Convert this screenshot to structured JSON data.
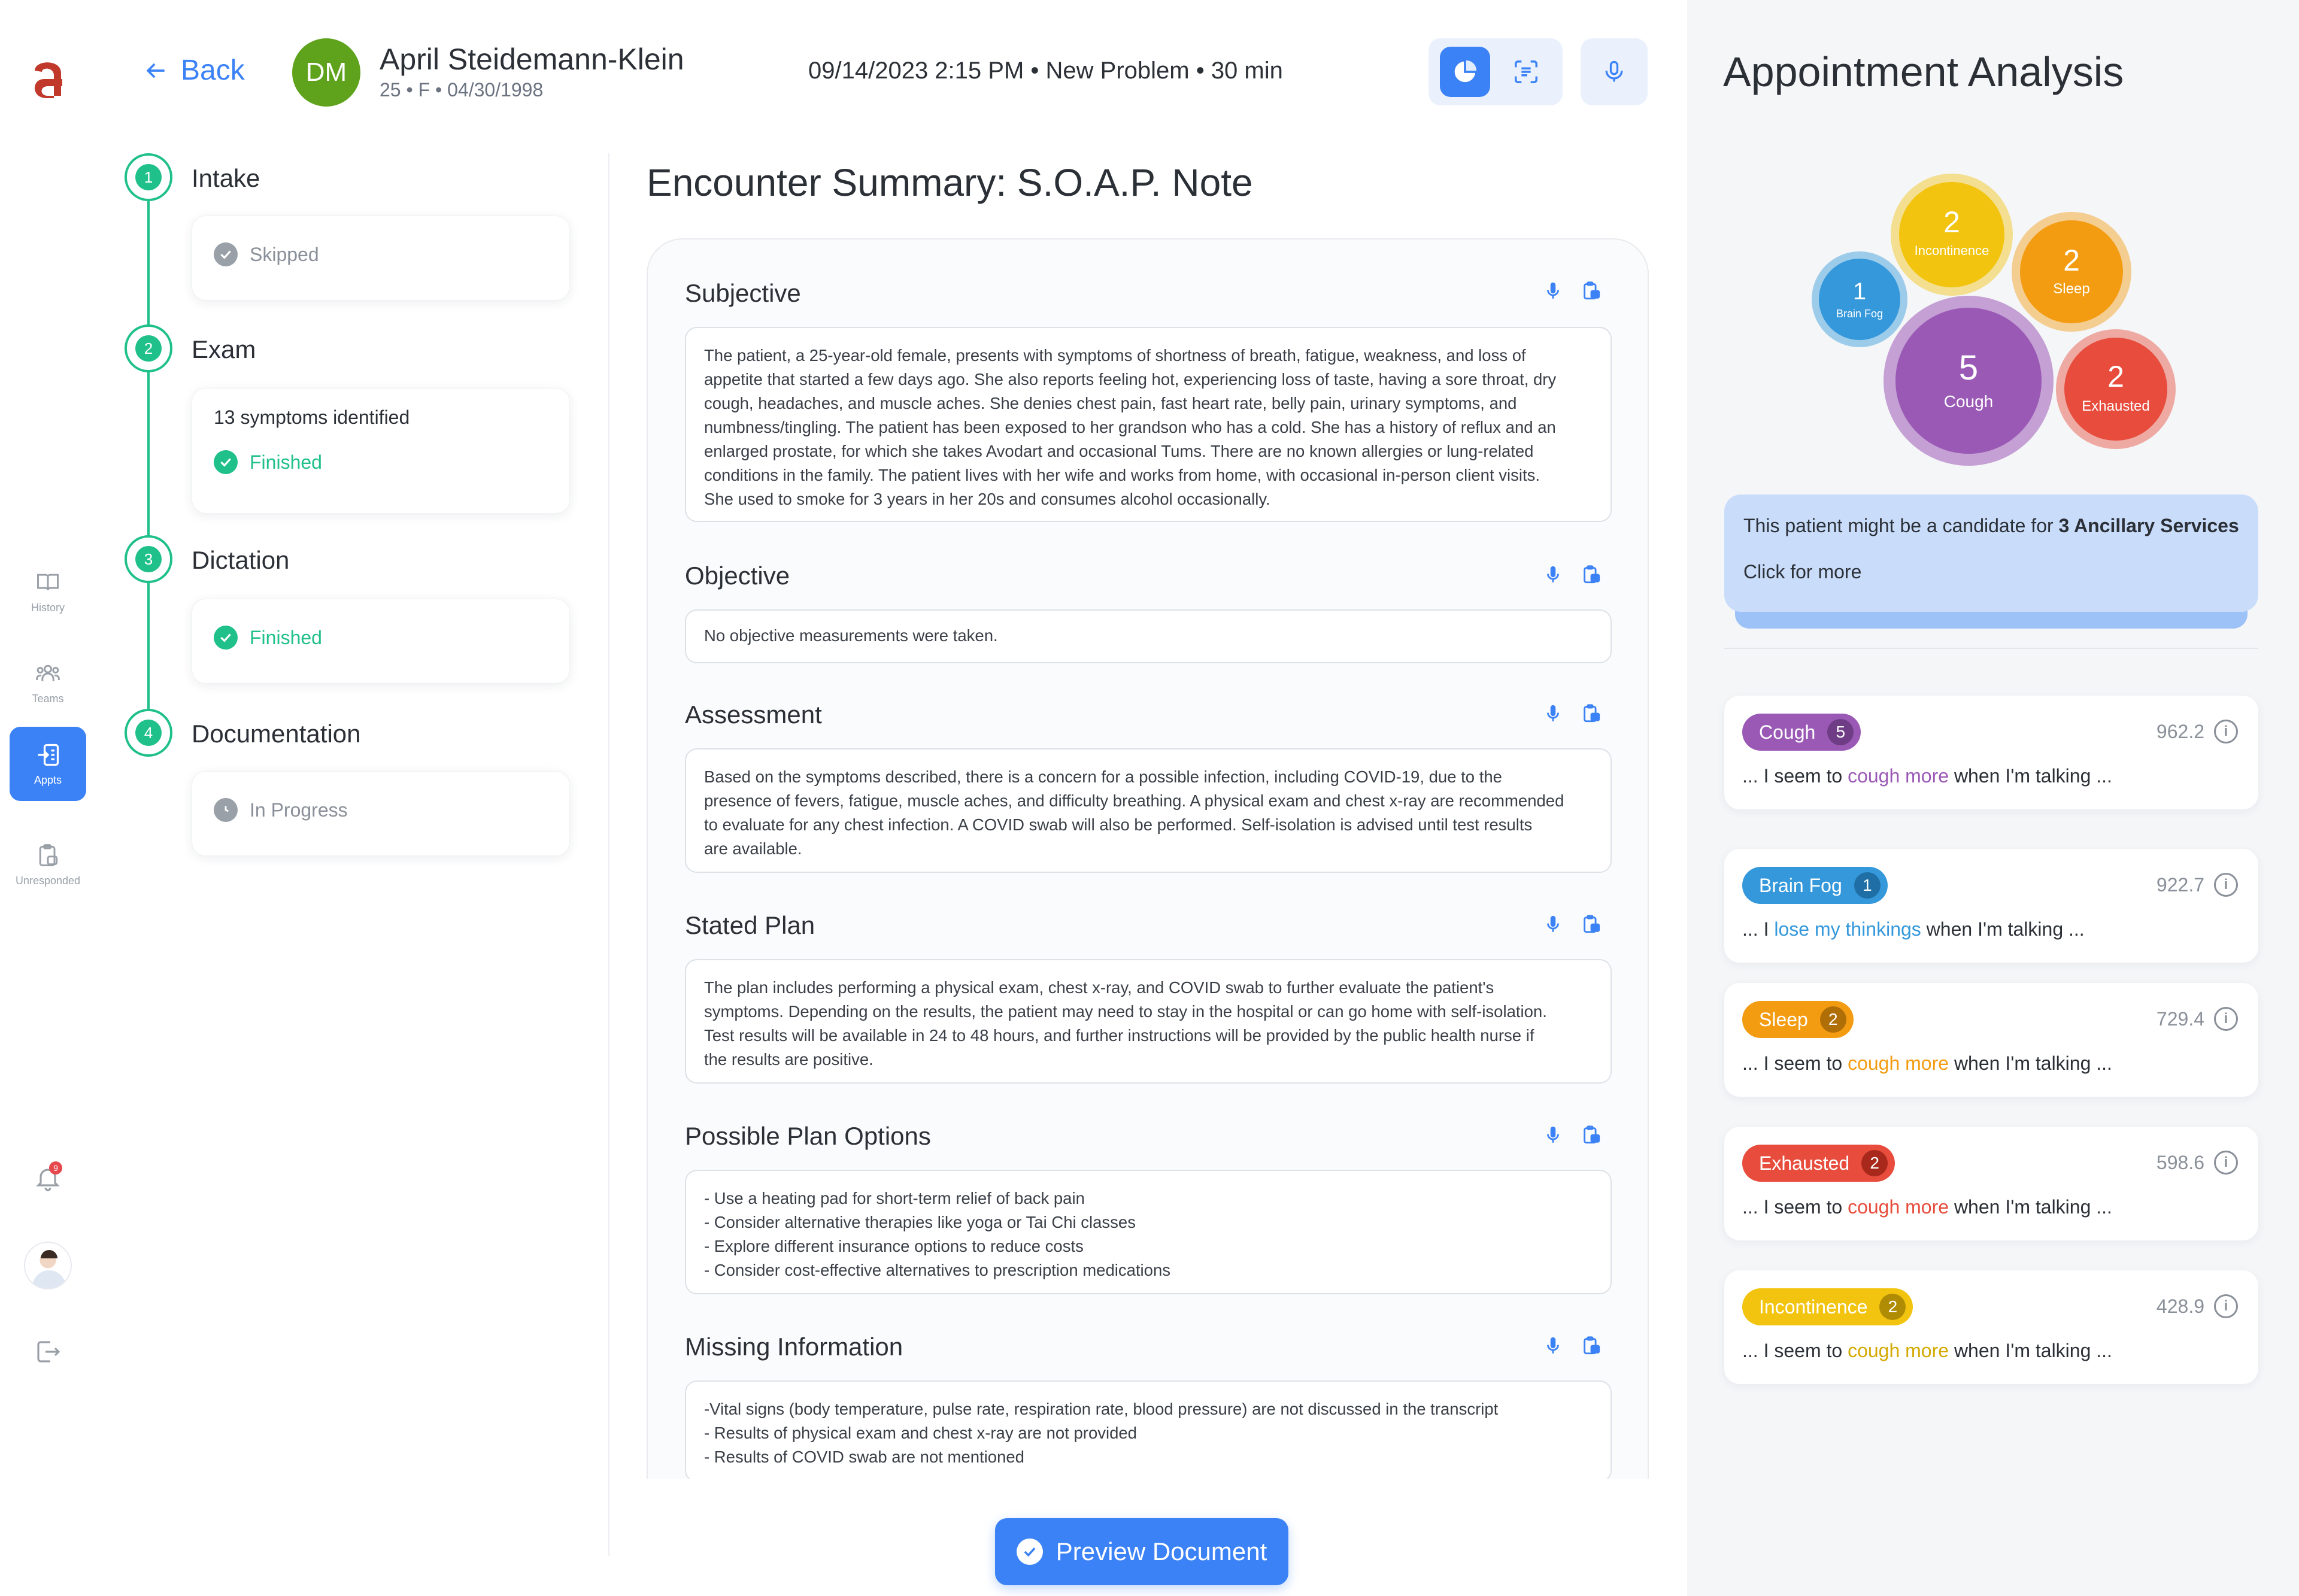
{
  "nav": {
    "items": [
      {
        "label": "History"
      },
      {
        "label": "Teams"
      },
      {
        "label": "Appts"
      },
      {
        "label": "Unresponded"
      }
    ],
    "notification_count": "9"
  },
  "header": {
    "back_label": "Back",
    "patient_initials": "DM",
    "patient_name": "April Steidemann-Klein",
    "patient_meta": "25 • F • 04/30/1998",
    "appointment": "09/14/2023 2:15 PM • New Problem • 30 min"
  },
  "steps": [
    {
      "num": "1",
      "title": "Intake",
      "status": "Skipped"
    },
    {
      "num": "2",
      "title": "Exam",
      "detail": "13 symptoms identified",
      "status": "Finished"
    },
    {
      "num": "3",
      "title": "Dictation",
      "status": "Finished"
    },
    {
      "num": "4",
      "title": "Documentation",
      "status": "In Progress"
    }
  ],
  "soap": {
    "title": "Encounter Summary: S.O.A.P. Note",
    "sections": [
      {
        "title": "Subjective",
        "text": "The patient, a 25-year-old female, presents with symptoms of shortness of breath, fatigue, weakness, and loss of\nappetite that started a few days ago. She also reports feeling hot, experiencing loss of taste, having a sore throat, dry\ncough, headaches, and muscle aches. She denies chest pain, fast heart rate, belly pain, urinary symptoms, and\nnumbness/tingling. The patient has been exposed to her grandson who has a cold. She has a history of reflux and an\nenlarged prostate, for which she takes Avodart and occasional Tums. There are no known allergies or lung-related\nconditions in the family. The patient lives with her wife and works from home, with occasional in-person client visits.\nShe used to smoke for 3 years in her 20s and consumes alcohol occasionally."
      },
      {
        "title": "Objective",
        "text": "No objective measurements were taken."
      },
      {
        "title": "Assessment",
        "text": "Based on the symptoms described, there is a concern for a possible infection, including COVID-19, due to the\npresence of fevers, fatigue, muscle aches, and difficulty breathing. A physical exam and chest x-ray are recommended\nto evaluate for any chest infection. A COVID swab will also be performed. Self-isolation is advised until test results\nare available."
      },
      {
        "title": "Stated Plan",
        "text": "The plan includes performing a physical exam, chest x-ray, and COVID swab to further evaluate the patient's\nsymptoms. Depending on the results, the patient may need to stay in the hospital or can go home with self-isolation.\nTest results will be available in 24 to 48 hours, and further instructions will be provided by the public health nurse if\nthe results are positive."
      },
      {
        "title": "Possible Plan Options",
        "text": "- Use a heating pad for short-term relief of back pain\n- Consider alternative therapies like yoga or Tai Chi classes\n- Explore different insurance options to reduce costs\n- Consider cost-effective alternatives to prescription medications"
      },
      {
        "title": "Missing Information",
        "text": "-Vital signs (body temperature, pulse rate, respiration rate, blood pressure) are not discussed in the transcript\n- Results of physical exam and chest x-ray are not provided\n- Results of COVID swab are not mentioned"
      }
    ],
    "preview_label": "Preview Document"
  },
  "analysis": {
    "title": "Appointment Analysis",
    "bubbles": [
      {
        "name": "Incontinence",
        "count": "2",
        "color": "#f2c40f"
      },
      {
        "name": "Sleep",
        "count": "2",
        "color": "#f39c12"
      },
      {
        "name": "Brain Fog",
        "count": "1",
        "color": "#3498db"
      },
      {
        "name": "Cough",
        "count": "5",
        "color": "#9b59b6"
      },
      {
        "name": "Exhausted",
        "count": "2",
        "color": "#e74c3c"
      }
    ],
    "ancillary_prefix": "This patient might be a candidate for ",
    "ancillary_bold": "3 Ancillary Services",
    "ancillary_more": "Click for more",
    "symptoms": [
      {
        "name": "Cough",
        "count": "5",
        "score": "962.2",
        "pre": "... I seem to ",
        "hl": "cough more",
        "post": " when I'm talking ...",
        "color": "#9b59b6",
        "dark": "#6e3d86"
      },
      {
        "name": "Brain Fog",
        "count": "1",
        "score": "922.7",
        "pre": "... I ",
        "hl": "lose my thinkings",
        "post": " when I'm talking ...",
        "color": "#3498db",
        "dark": "#1f6fa6"
      },
      {
        "name": "Sleep",
        "count": "2",
        "score": "729.4",
        "pre": "... I seem to ",
        "hl": "cough more",
        "post": " when I'm talking ...",
        "color": "#f39c12",
        "dark": "#b06e06"
      },
      {
        "name": "Exhausted",
        "count": "2",
        "score": "598.6",
        "pre": "... I seem to ",
        "hl": "cough more",
        "post": " when I'm talking ...",
        "color": "#e74c3c",
        "dark": "#a8291c"
      },
      {
        "name": "Incontinence",
        "count": "2",
        "score": "428.9",
        "pre": "... I seem to ",
        "hl": "cough more",
        "post": " when I'm talking ...",
        "color": "#f2c40f",
        "dark": "#b08c05"
      }
    ]
  }
}
